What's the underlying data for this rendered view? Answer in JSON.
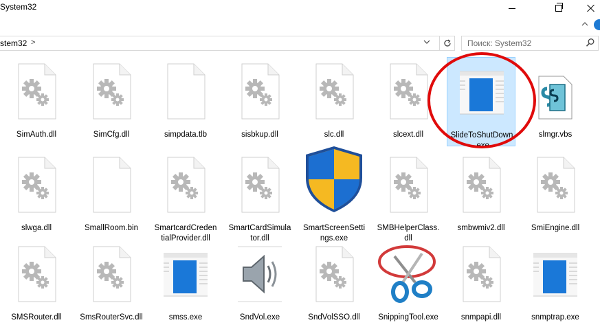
{
  "window": {
    "title": "System32"
  },
  "address_bar": {
    "path": "stem32",
    "separator": ">"
  },
  "search": {
    "placeholder": "Поиск: System32"
  },
  "files": [
    {
      "name_line1": "SimAuth.dll",
      "name_line2": "",
      "icon": "gear-dll-icon"
    },
    {
      "name_line1": "SimCfg.dll",
      "name_line2": "",
      "icon": "gear-dll-icon"
    },
    {
      "name_line1": "simpdata.tlb",
      "name_line2": "",
      "icon": "blank-file-icon"
    },
    {
      "name_line1": "sisbkup.dll",
      "name_line2": "",
      "icon": "gear-dll-icon"
    },
    {
      "name_line1": "slc.dll",
      "name_line2": "",
      "icon": "gear-dll-icon"
    },
    {
      "name_line1": "slcext.dll",
      "name_line2": "",
      "icon": "gear-dll-icon"
    },
    {
      "name_line1": "SlideToShutDown",
      "name_line2": ".exe",
      "icon": "app-window-icon",
      "selected": true
    },
    {
      "name_line1": "slmgr.vbs",
      "name_line2": "",
      "icon": "script-file-icon"
    },
    {
      "name_line1": "slwga.dll",
      "name_line2": "",
      "icon": "gear-dll-icon"
    },
    {
      "name_line1": "SmallRoom.bin",
      "name_line2": "",
      "icon": "blank-file-icon"
    },
    {
      "name_line1": "SmartcardCreden",
      "name_line2": "tialProvider.dll",
      "icon": "gear-dll-icon"
    },
    {
      "name_line1": "SmartCardSimula",
      "name_line2": "tor.dll",
      "icon": "gear-dll-icon"
    },
    {
      "name_line1": "SmartScreenSetti",
      "name_line2": "ngs.exe",
      "icon": "uac-shield-icon"
    },
    {
      "name_line1": "SMBHelperClass.",
      "name_line2": "dll",
      "icon": "gear-dll-icon"
    },
    {
      "name_line1": "smbwmiv2.dll",
      "name_line2": "",
      "icon": "gear-dll-icon"
    },
    {
      "name_line1": "SmiEngine.dll",
      "name_line2": "",
      "icon": "gear-dll-icon"
    },
    {
      "name_line1": "SMSRouter.dll",
      "name_line2": "",
      "icon": "gear-dll-icon"
    },
    {
      "name_line1": "SmsRouterSvc.dll",
      "name_line2": "",
      "icon": "gear-dll-icon"
    },
    {
      "name_line1": "smss.exe",
      "name_line2": "",
      "icon": "app-window-icon"
    },
    {
      "name_line1": "SndVol.exe",
      "name_line2": "",
      "icon": "speaker-icon"
    },
    {
      "name_line1": "SndVolSSO.dll",
      "name_line2": "",
      "icon": "gear-dll-icon"
    },
    {
      "name_line1": "SnippingTool.exe",
      "name_line2": "",
      "icon": "scissors-icon"
    },
    {
      "name_line1": "snmpapi.dll",
      "name_line2": "",
      "icon": "gear-dll-icon"
    },
    {
      "name_line1": "snmptrap.exe",
      "name_line2": "",
      "icon": "app-window-icon"
    }
  ],
  "colors": {
    "selection": "#cce8ff",
    "highlight_circle": "#e00b0b",
    "accent": "#1e7ad3"
  }
}
